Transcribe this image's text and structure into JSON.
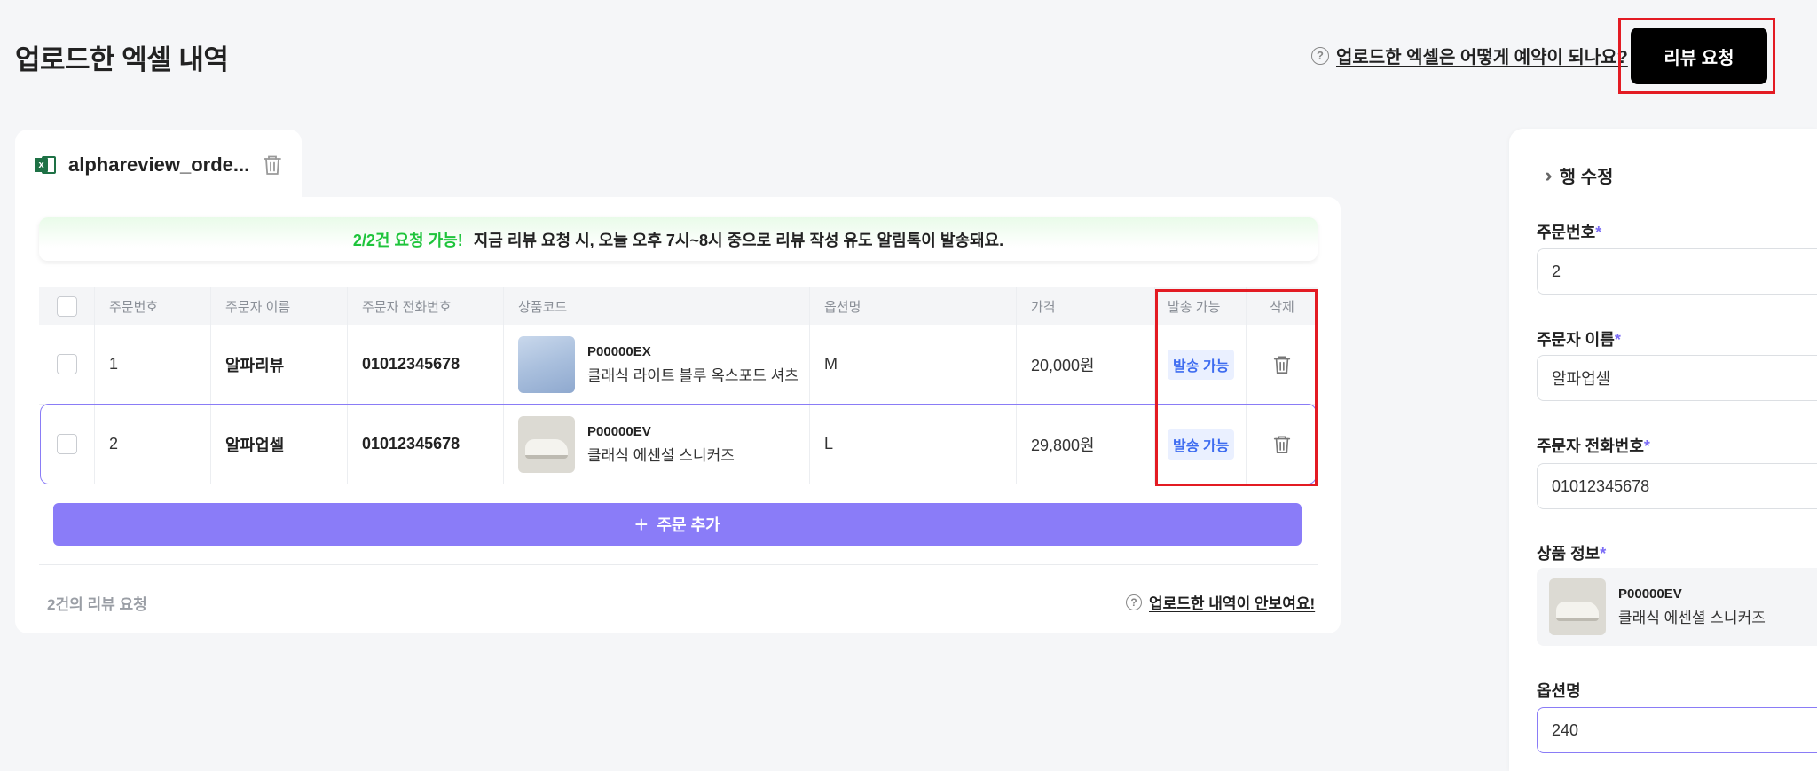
{
  "header": {
    "title": "업로드한 엑셀 내역",
    "help_link": "업로드한 엑셀은 어떻게 예약이 되나요?",
    "review_button": "리뷰 요청"
  },
  "file_tab": {
    "name": "alphareview_orde..."
  },
  "notice": {
    "highlight": "2/2건 요청 가능!",
    "message": "지금 리뷰 요청 시, 오늘 오후 7시~8시 중으로 리뷰 작성 유도 알림톡이 발송돼요."
  },
  "table": {
    "columns": {
      "order_no": "주문번호",
      "name": "주문자 이름",
      "phone": "주문자 전화번호",
      "product": "상품코드",
      "option": "옵션명",
      "price": "가격",
      "sendable": "발송 가능",
      "delete": "삭제"
    },
    "rows": [
      {
        "order_no": "1",
        "name": "알파리뷰",
        "phone": "01012345678",
        "product_code": "P00000EX",
        "product_name": "클래식 라이트 블루 옥스포드 셔츠",
        "option": "M",
        "price": "20,000원",
        "status": "발송 가능"
      },
      {
        "order_no": "2",
        "name": "알파업셀",
        "phone": "01012345678",
        "product_code": "P00000EV",
        "product_name": "클래식 에센셜 스니커즈",
        "option": "L",
        "price": "29,800원",
        "status": "발송 가능"
      }
    ],
    "add_button": "주문 추가"
  },
  "footer": {
    "count": "2건의 리뷰 요청",
    "help_link": "업로드한 내역이 안보여요!"
  },
  "side_panel": {
    "title": "행 수정",
    "fields": {
      "order_no": {
        "label": "주문번호",
        "value": "2"
      },
      "name": {
        "label": "주문자 이름",
        "value": "알파업셀"
      },
      "phone": {
        "label": "주문자 전화번호",
        "value": "01012345678"
      },
      "product": {
        "label": "상품 정보",
        "code": "P00000EV",
        "name": "클래식 에센셜 스니커즈"
      },
      "option": {
        "label": "옵션명",
        "value": "240"
      }
    },
    "required_mark": "*"
  },
  "colors": {
    "accent": "#8a7cf8",
    "highlight_red": "#e31b23",
    "success_green": "#1ec43b",
    "badge_blue": "#3e6cf0"
  }
}
